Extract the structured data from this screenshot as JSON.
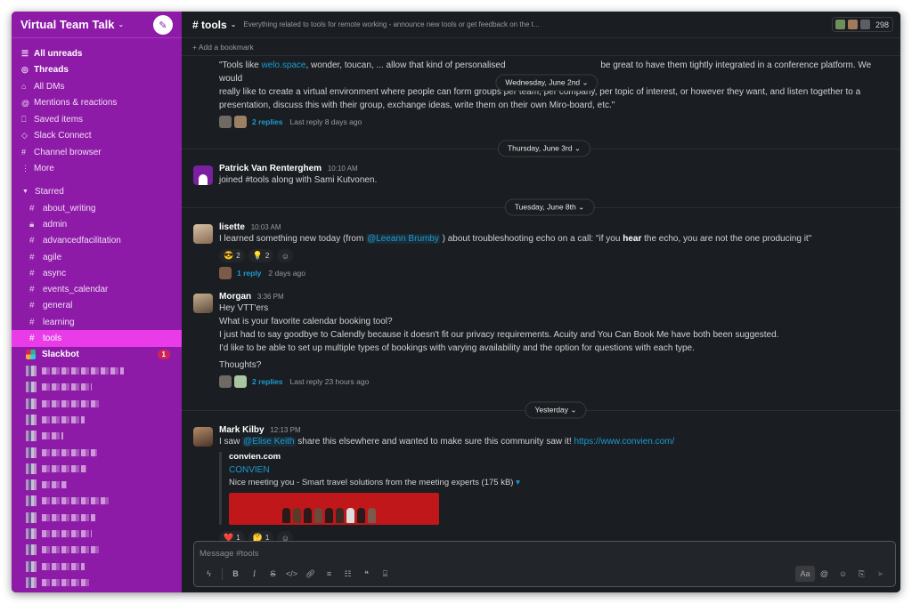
{
  "workspace": {
    "name": "Virtual Team Talk"
  },
  "nav": [
    {
      "label": "All unreads",
      "icon": "list-icon",
      "bold": true
    },
    {
      "label": "Threads",
      "icon": "threads-icon",
      "bold": true
    },
    {
      "label": "All DMs",
      "icon": "dms-icon",
      "bold": false
    },
    {
      "label": "Mentions & reactions",
      "icon": "at-icon",
      "bold": false
    },
    {
      "label": "Saved items",
      "icon": "bookmark-icon",
      "bold": false
    },
    {
      "label": "Slack Connect",
      "icon": "slack-connect-icon",
      "bold": false
    },
    {
      "label": "Channel browser",
      "icon": "channel-browser-icon",
      "bold": false
    },
    {
      "label": "More",
      "icon": "more-icon",
      "bold": false
    }
  ],
  "starred": {
    "label": "Starred",
    "channels": [
      {
        "name": "about_writing",
        "icon": "#"
      },
      {
        "name": "admin",
        "icon": "lock"
      },
      {
        "name": "advancedfacilitation",
        "icon": "#"
      },
      {
        "name": "agile",
        "icon": "#"
      },
      {
        "name": "async",
        "icon": "#"
      },
      {
        "name": "events_calendar",
        "icon": "#"
      },
      {
        "name": "general",
        "icon": "#"
      },
      {
        "name": "learning",
        "icon": "#"
      },
      {
        "name": "tools",
        "icon": "#",
        "active": true
      }
    ]
  },
  "slackbot": {
    "name": "Slackbot",
    "badge": "1"
  },
  "channel": {
    "name": "# tools",
    "topic": "Everything related to tools for remote working - announce new tools or get feedback on the t...",
    "member_count": "298",
    "bookmark_label": "+ Add a bookmark"
  },
  "colors": {
    "sidebar": "#8e1ba8",
    "active_channel": "#e93ce8",
    "link": "#1d9bd1",
    "background": "#1a1d21"
  },
  "feed": {
    "first_message": {
      "line1_pre": "\"Tools like ",
      "line1_link": "welo.space",
      "line1_post": ", wonder, toucan, ... allow that kind of personalised",
      "line1_rest": "be great to have them tightly integrated in a conference platform. We would",
      "line2": "really like to create a virtual environment where people can form groups per team, per company, per topic of interest, or however they want, and listen together to a",
      "line3": "presentation, discuss this with their group, exchange ideas, write them on their own Miro-board, etc.\"",
      "replies": "2 replies",
      "last_reply": "Last reply 8 days ago"
    },
    "floating_date": "Wednesday, June 2nd",
    "date1": "Thursday, June 3rd",
    "patrick": {
      "author": "Patrick Van Renterghem",
      "time": "10:10 AM",
      "text": "joined #tools along with Sami Kutvonen."
    },
    "date2": "Tuesday, June 8th",
    "lisette": {
      "author": "lisette",
      "time": "10:03 AM",
      "text_pre": "I learned something new today (from ",
      "mention": "@Leeann Brumby",
      "text_mid": " ) about troubleshooting echo on a call: \"if you ",
      "bold": "hear",
      "text_post": " the echo, you are not the one producing it\"",
      "reactions": [
        {
          "emoji": "😎",
          "count": "2"
        },
        {
          "emoji": "💡",
          "count": "2"
        }
      ],
      "replies": "1 reply",
      "last_reply": "2 days ago"
    },
    "morgan": {
      "author": "Morgan",
      "time": "3:36 PM",
      "lines": [
        "Hey VTT'ers",
        "What is your favorite calendar booking tool?",
        "I just had to say goodbye to Calendly because it doesn't fit our privacy requirements. Acuity and You Can Book Me have both been suggested.",
        "I'd like to be able to set up multiple types of bookings with varying availability and the option for questions with each type."
      ],
      "closing": "Thoughts?",
      "replies": "2 replies",
      "last_reply": "Last reply 23 hours ago"
    },
    "date3": "Yesterday",
    "mark": {
      "author": "Mark Kilby",
      "time": "12:13 PM",
      "text_pre": "I saw ",
      "mention": "@Elise Keith",
      "text_mid": " share this elsewhere and wanted to make sure this community saw it!  ",
      "link": "https://www.convien.com/",
      "unfurl_site": "convien.com",
      "unfurl_title": "CONVIEN",
      "unfurl_desc": "Nice meeting you - Smart travel solutions from the meeting experts (175 kB)",
      "unfurl_arrow": "▾",
      "reactions": [
        {
          "emoji": "❤️",
          "count": "1"
        },
        {
          "emoji": "🤔",
          "count": "1"
        }
      ]
    }
  },
  "composer": {
    "placeholder": "Message #tools",
    "aa": "Aa"
  }
}
